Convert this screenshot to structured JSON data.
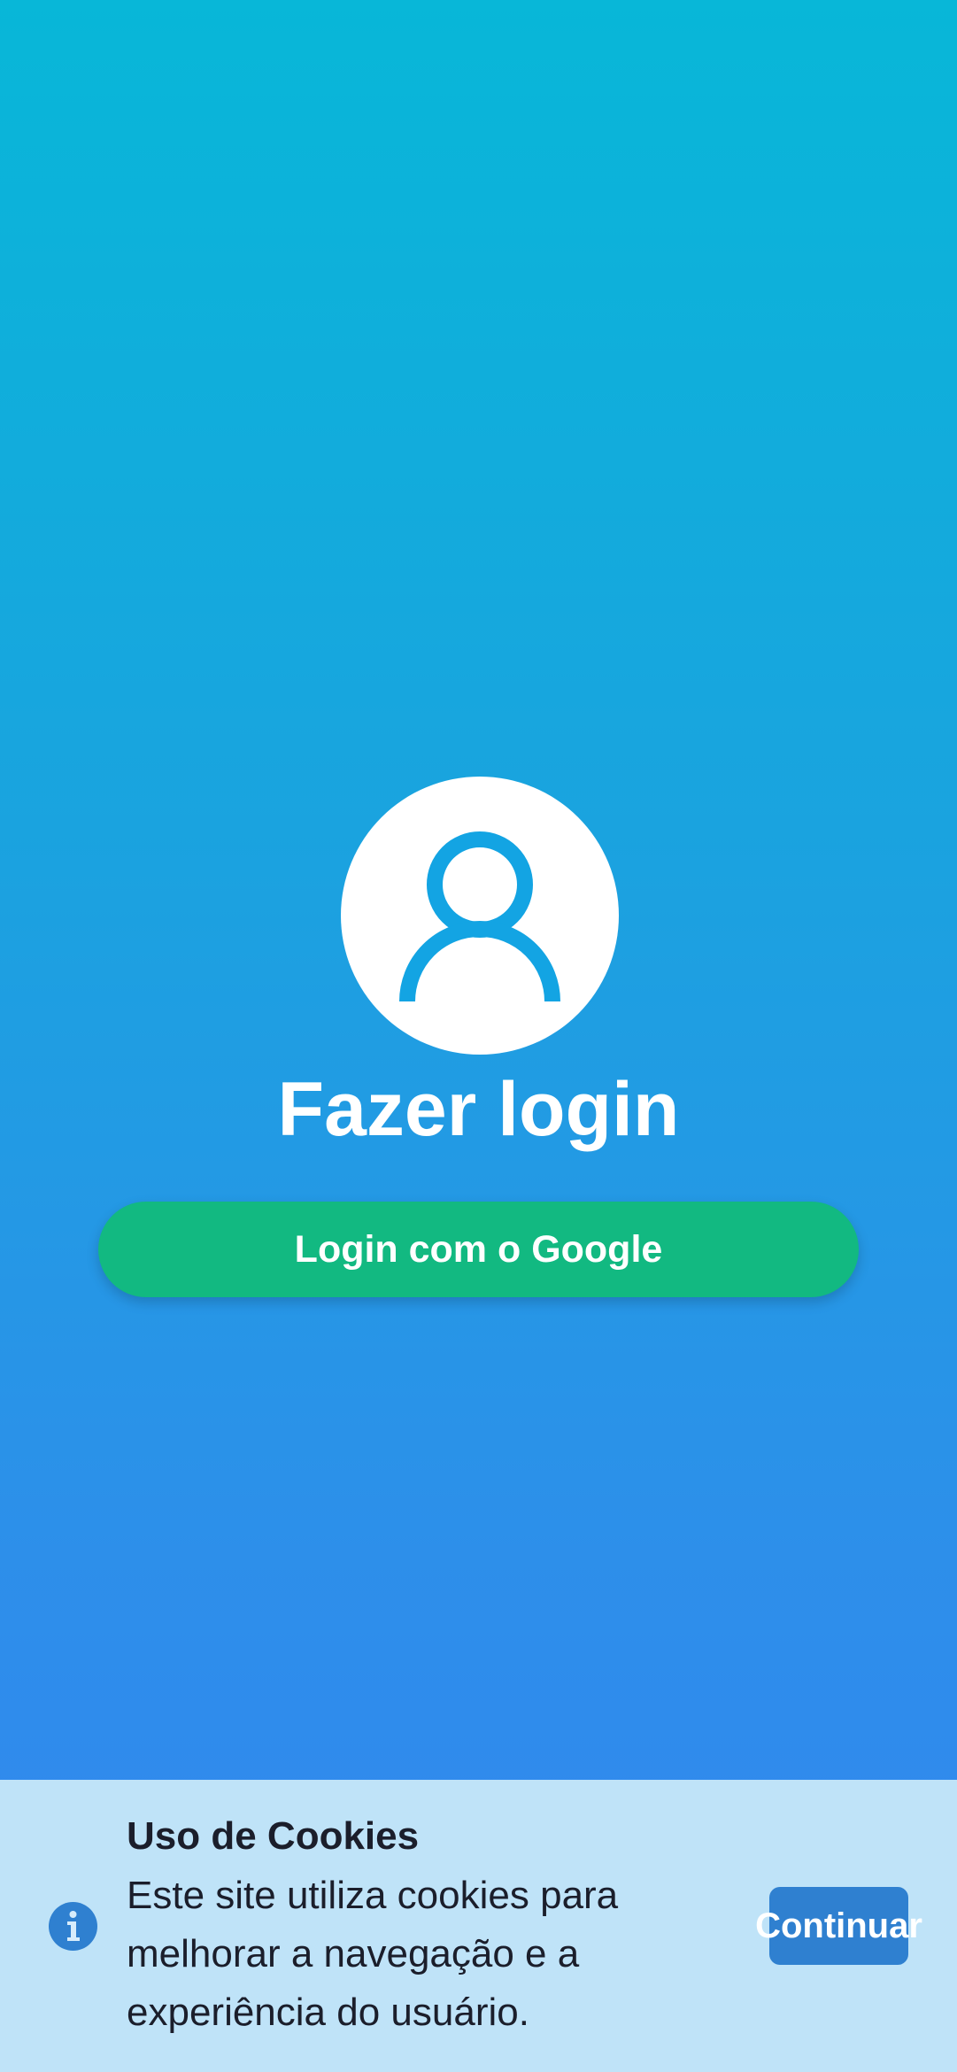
{
  "login": {
    "title": "Fazer login",
    "google_button_label": "Login com o Google"
  },
  "cookies": {
    "title": "Uso de Cookies",
    "message": "Este site utiliza cookies para melhorar a navegação e a experiência do usuário.",
    "continue_label": "Continuar"
  },
  "icons": {
    "avatar": "user-icon",
    "info": "info-icon"
  },
  "colors": {
    "background_top": "#08b7d8",
    "background_bottom": "#3385f0",
    "google_button": "#12b981",
    "cookie_bar": "#bfe3f8",
    "accent": "#2f80d0",
    "user_icon": "#13a4e3"
  }
}
